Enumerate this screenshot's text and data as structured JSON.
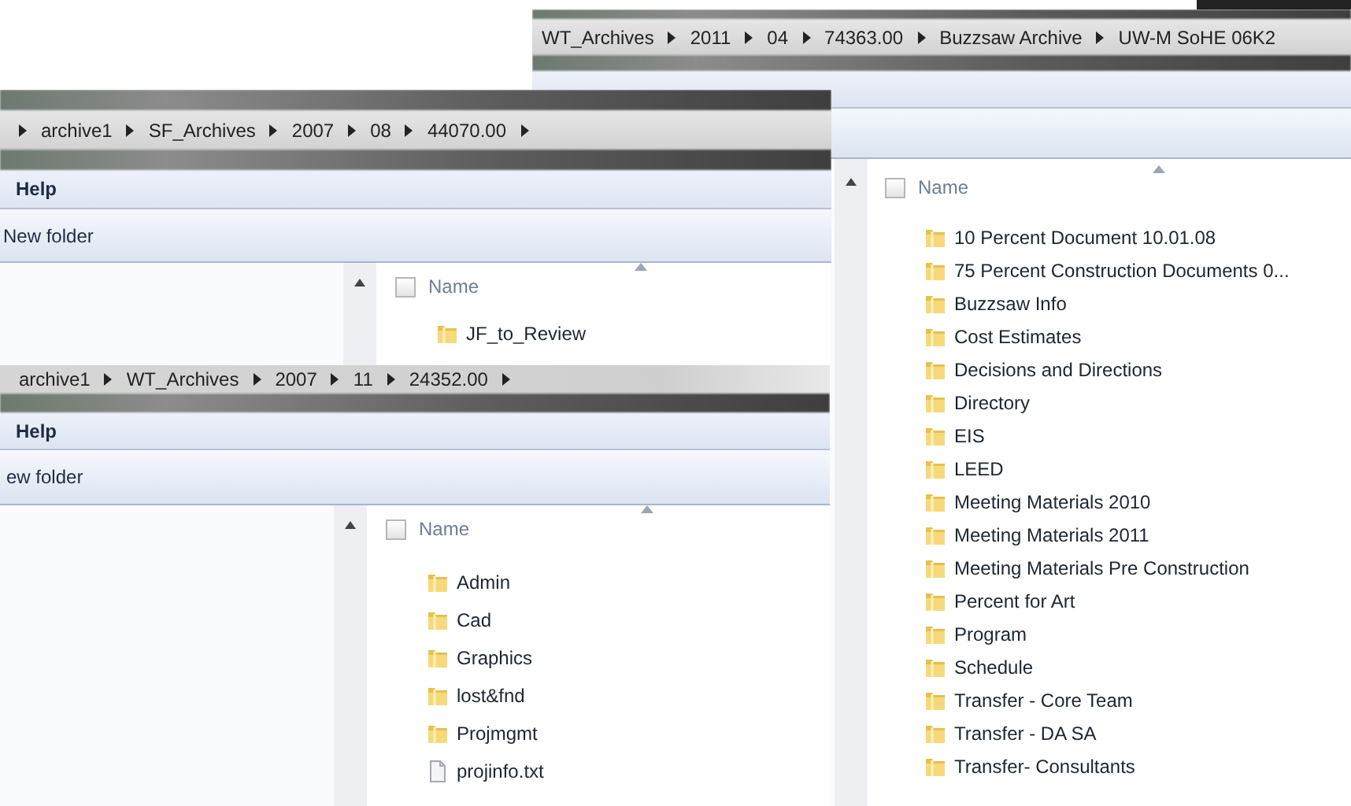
{
  "windows": [
    {
      "breadcrumb": {
        "leading_arrow": false,
        "trailing_arrow": false,
        "segments": [
          "WT_Archives",
          "2011",
          "04",
          "74363.00",
          "Buzzsaw Archive",
          "UW-M SoHE 06K2"
        ]
      },
      "column_header": "Name",
      "select_all_checked": false,
      "items": [
        {
          "name": "10 Percent Document 10.01.08",
          "kind": "folder"
        },
        {
          "name": "75 Percent Construction Documents 0...",
          "kind": "folder"
        },
        {
          "name": "Buzzsaw Info",
          "kind": "folder"
        },
        {
          "name": "Cost Estimates",
          "kind": "folder"
        },
        {
          "name": "Decisions and Directions",
          "kind": "folder"
        },
        {
          "name": "Directory",
          "kind": "folder"
        },
        {
          "name": "EIS",
          "kind": "folder"
        },
        {
          "name": "LEED",
          "kind": "folder"
        },
        {
          "name": "Meeting Materials 2010",
          "kind": "folder"
        },
        {
          "name": "Meeting Materials 2011",
          "kind": "folder"
        },
        {
          "name": "Meeting Materials Pre Construction",
          "kind": "folder"
        },
        {
          "name": "Percent for Art",
          "kind": "folder"
        },
        {
          "name": "Program",
          "kind": "folder"
        },
        {
          "name": "Schedule",
          "kind": "folder"
        },
        {
          "name": "Transfer - Core Team",
          "kind": "folder"
        },
        {
          "name": "Transfer - DA SA",
          "kind": "folder"
        },
        {
          "name": "Transfer- Consultants",
          "kind": "folder"
        }
      ]
    },
    {
      "breadcrumb": {
        "leading_arrow": true,
        "trailing_arrow": true,
        "segments": [
          "archive1",
          "SF_Archives",
          "2007",
          "08",
          "44070.00"
        ]
      },
      "menu": [
        "Help"
      ],
      "toolbar": [
        "New folder"
      ],
      "column_header": "Name",
      "select_all_checked": false,
      "items": [
        {
          "name": "JF_to_Review",
          "kind": "folder"
        }
      ]
    },
    {
      "breadcrumb": {
        "leading_arrow": false,
        "trailing_arrow": true,
        "segments": [
          "archive1",
          "WT_Archives",
          "2007",
          "11",
          "24352.00"
        ]
      },
      "menu": [
        "Help"
      ],
      "toolbar": [
        "ew folder"
      ],
      "column_header": "Name",
      "select_all_checked": false,
      "items": [
        {
          "name": "Admin",
          "kind": "folder"
        },
        {
          "name": "Cad",
          "kind": "folder"
        },
        {
          "name": "Graphics",
          "kind": "folder"
        },
        {
          "name": "lost&fnd",
          "kind": "folder"
        },
        {
          "name": "Projmgmt",
          "kind": "folder"
        },
        {
          "name": "projinfo.txt",
          "kind": "file"
        }
      ]
    }
  ]
}
